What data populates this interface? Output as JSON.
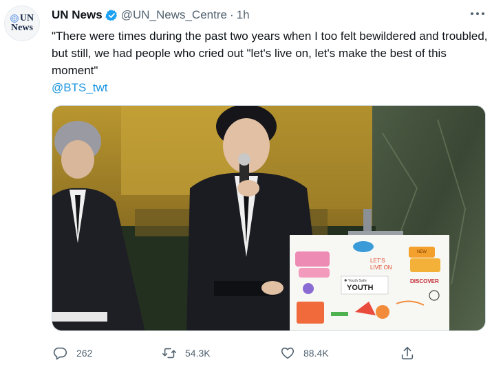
{
  "author": {
    "avatar_text": "UN",
    "avatar_text_2": "News",
    "name": "UN News",
    "handle": "@UN_News_Centre",
    "separator": "·",
    "time": "1h"
  },
  "tweet": {
    "text": "\"There were times during the past two years when I too felt bewildered and troubled, but still, we had people who cried out \"let's live on, let's make the best of this moment\"",
    "mention": "@BTS_twt"
  },
  "media": {
    "board": {
      "line1": "LET'S",
      "line2": "LIVE ON",
      "youth_top": "✱ Youth Safe",
      "youth": "YOUTH",
      "new": "NEW",
      "discover": "DISCOVER"
    }
  },
  "actions": {
    "replies": "262",
    "retweets": "54.3K",
    "likes": "88.4K"
  },
  "icons": [
    "un-emblem-icon",
    "verified-badge-icon",
    "more-icon",
    "reply-icon",
    "retweet-icon",
    "like-icon",
    "share-icon"
  ],
  "colors": {
    "text": "#0f1419",
    "secondary": "#536471",
    "link": "#1b95e0",
    "verified": "#1da1f2"
  }
}
